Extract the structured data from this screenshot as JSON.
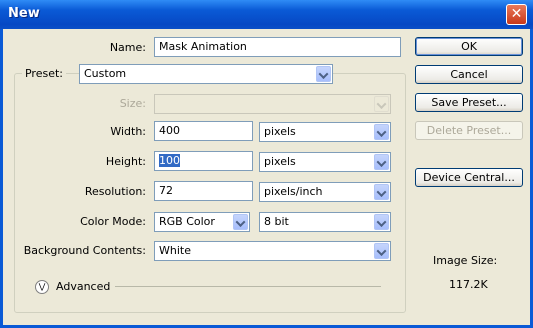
{
  "window": {
    "title": "New",
    "close_glyph": "✕"
  },
  "name": {
    "label": "Name:",
    "value": "Mask Animation"
  },
  "preset": {
    "label": "Preset:",
    "value": "Custom"
  },
  "size": {
    "label": "Size:",
    "value": ""
  },
  "width": {
    "label": "Width:",
    "value": "400",
    "unit": "pixels"
  },
  "height": {
    "label": "Height:",
    "value": "100",
    "unit": "pixels"
  },
  "resolution": {
    "label": "Resolution:",
    "value": "72",
    "unit": "pixels/inch"
  },
  "color_mode": {
    "label": "Color Mode:",
    "value": "RGB Color",
    "depth": "8 bit"
  },
  "background": {
    "label": "Background Contents:",
    "value": "White"
  },
  "advanced": {
    "label": "Advanced",
    "icon": "chevron-double-down-icon"
  },
  "buttons": {
    "ok": "OK",
    "cancel": "Cancel",
    "save_preset": "Save Preset...",
    "delete_preset": "Delete Preset...",
    "device_central": "Device Central..."
  },
  "image_size": {
    "label": "Image Size:",
    "value": "117.2K"
  },
  "colors": {
    "titlebar": "#0a5ad6",
    "dialog_bg": "#ece9d8",
    "selection": "#316ac5"
  }
}
